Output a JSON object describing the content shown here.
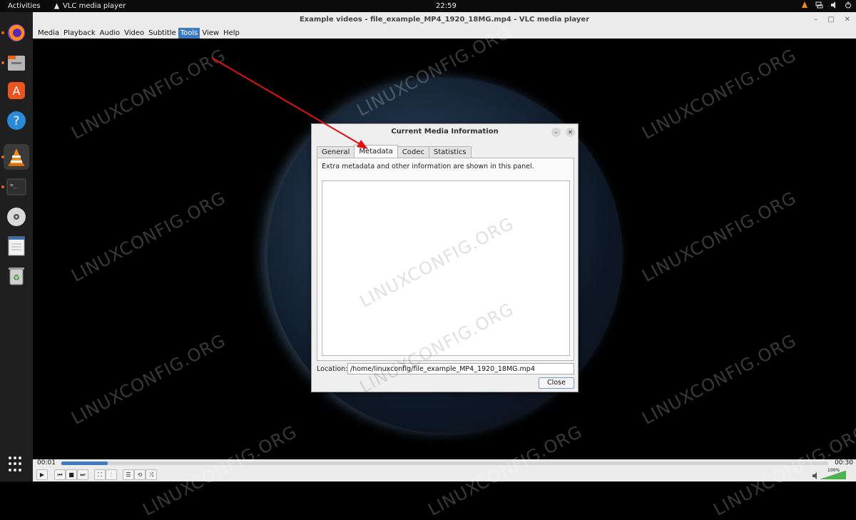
{
  "topbar": {
    "activities": "Activities",
    "app_name": "VLC media player",
    "clock": "22:59"
  },
  "dock": {
    "items": [
      "firefox-icon",
      "files-icon",
      "app-center-icon",
      "help-icon",
      "vlc-icon",
      "terminal-icon",
      "disc-icon",
      "text-editor-icon",
      "trash-icon"
    ]
  },
  "window": {
    "title": "Example videos - file_example_MP4_1920_18MG.mp4 - VLC media player"
  },
  "menubar": {
    "items": [
      "Media",
      "Playback",
      "Audio",
      "Video",
      "Subtitle",
      "Tools",
      "View",
      "Help"
    ],
    "selected": "Tools"
  },
  "watermark": "LINUXCONFIG.ORG",
  "dialog": {
    "title": "Current Media Information",
    "tabs": [
      "General",
      "Metadata",
      "Codec",
      "Statistics"
    ],
    "active_tab": "Metadata",
    "description": "Extra metadata and other information are shown in this panel.",
    "location_label": "Location:",
    "location_value": "/home/linuxconfig/file_example_MP4_1920_18MG.mp4",
    "close_label": "Close"
  },
  "player": {
    "elapsed": "00:01",
    "total": "00:30",
    "progress": 0.06,
    "volume": "100%",
    "accent": "#3c7bc0"
  }
}
